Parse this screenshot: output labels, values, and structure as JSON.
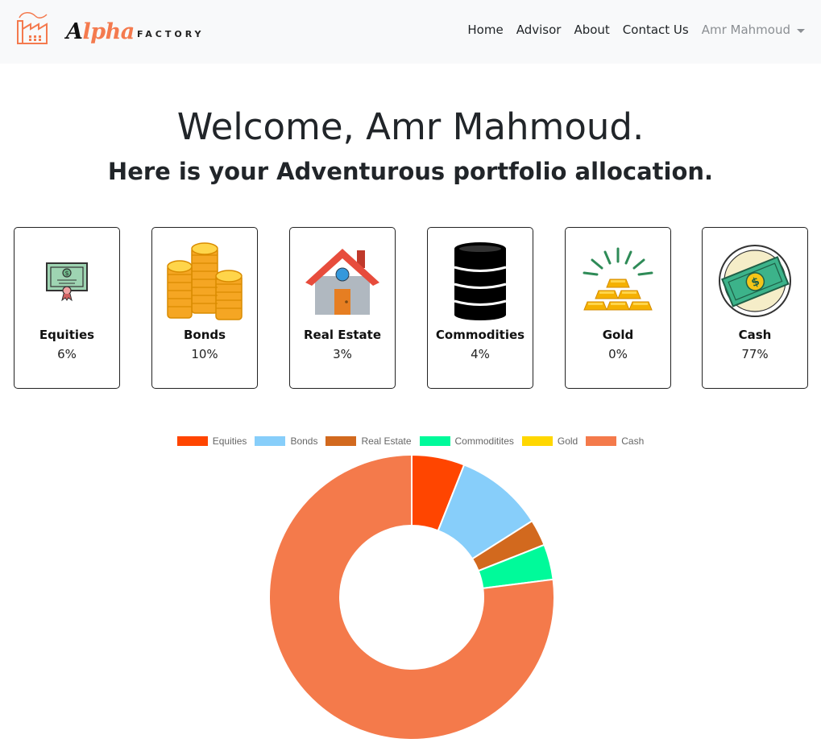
{
  "navbar": {
    "brand_script": "Alpha",
    "brand_sub": "FACTORY",
    "links": [
      "Home",
      "Advisor",
      "About",
      "Contact Us"
    ],
    "user_name": "Amr Mahmoud"
  },
  "hero": {
    "title": "Welcome, Amr Mahmoud.",
    "subtitle": "Here is your Adventurous portfolio allocation."
  },
  "cards": [
    {
      "label": "Equities",
      "value": "6%",
      "icon": "certificate-icon"
    },
    {
      "label": "Bonds",
      "value": "10%",
      "icon": "coin-stacks-icon"
    },
    {
      "label": "Real Estate",
      "value": "3%",
      "icon": "house-icon"
    },
    {
      "label": "Commodities",
      "value": "4%",
      "icon": "oil-barrel-icon"
    },
    {
      "label": "Gold",
      "value": "0%",
      "icon": "gold-bars-icon"
    },
    {
      "label": "Cash",
      "value": "77%",
      "icon": "cash-coin-icon"
    }
  ],
  "chart_data": {
    "type": "pie",
    "variant": "doughnut",
    "categories": [
      "Equities",
      "Bonds",
      "Real Estate",
      "Commoditites",
      "Gold",
      "Cash"
    ],
    "values": [
      6,
      10,
      3,
      4,
      0,
      77
    ],
    "colors": [
      "#ff4500",
      "#87cefa",
      "#d2691e",
      "#00fa9a",
      "#ffd700",
      "#f47a4b"
    ],
    "legend_position": "top"
  },
  "colors": {
    "brand_orange": "#f47a4e",
    "navbar_bg": "#f8f9fa"
  }
}
